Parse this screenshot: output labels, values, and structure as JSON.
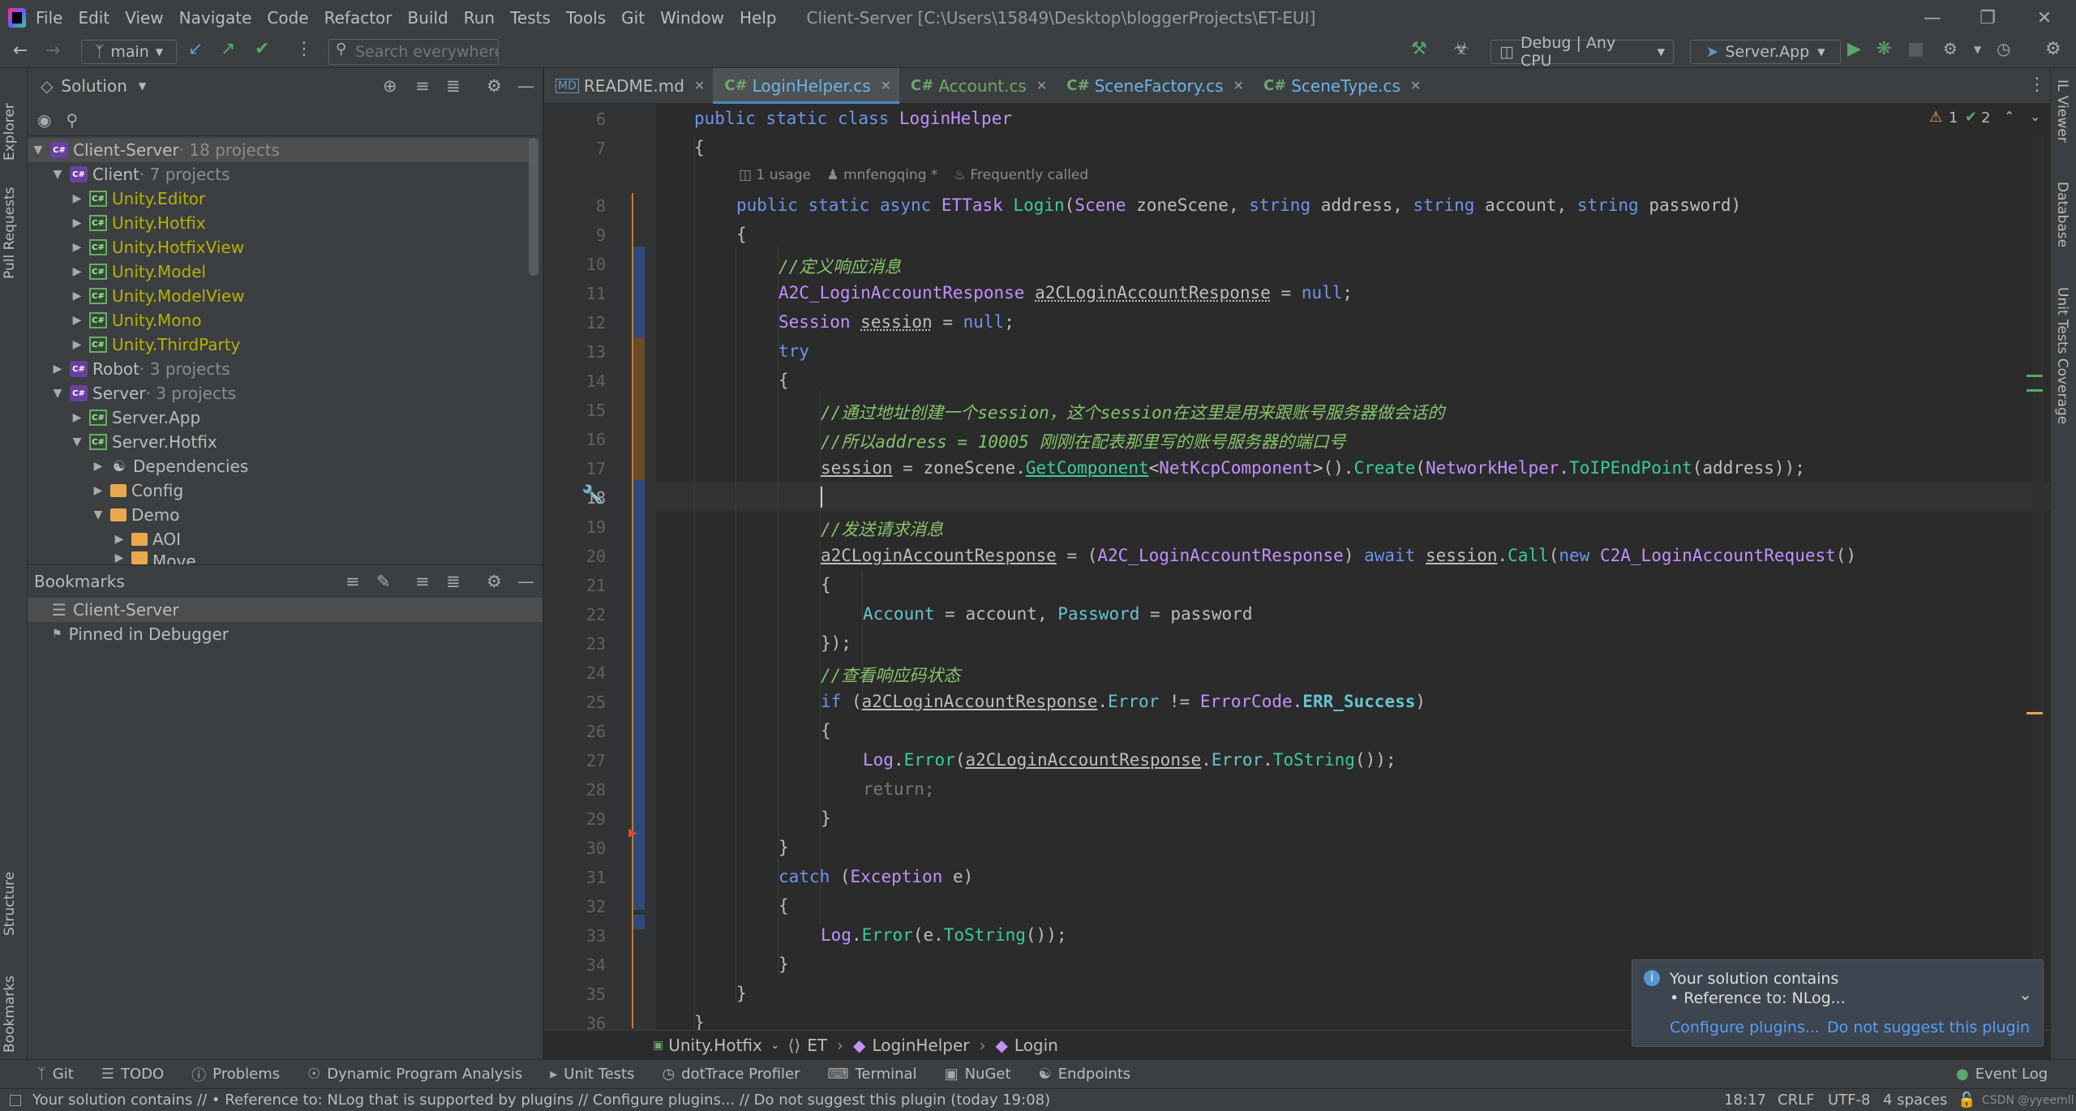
{
  "menubar": {
    "items": [
      "File",
      "Edit",
      "View",
      "Navigate",
      "Code",
      "Refactor",
      "Build",
      "Run",
      "Tests",
      "Tools",
      "Git",
      "Window",
      "Help"
    ],
    "title": "Client-Server [C:\\Users\\15849\\Desktop\\bloggerProjects\\ET-EUI]"
  },
  "toolbar": {
    "branch": "main",
    "search_placeholder": "Search everywhere",
    "config": "Debug | Any CPU",
    "run_target": "Server.App"
  },
  "left_strip": {
    "explorer": "Explorer",
    "pull_requests": "Pull Requests",
    "structure": "Structure",
    "bookmarks": "Bookmarks"
  },
  "right_strip": {
    "il_viewer": "IL Viewer",
    "database": "Database",
    "coverage": "Unit Tests Coverage"
  },
  "solution": {
    "title": "Solution",
    "root_name": "Client-Server",
    "root_count": " · 18 projects",
    "client_name": "Client",
    "client_count": " · 7 projects",
    "client_projects": [
      "Unity.Editor",
      "Unity.Hotfix",
      "Unity.HotfixView",
      "Unity.Model",
      "Unity.ModelView",
      "Unity.Mono",
      "Unity.ThirdParty"
    ],
    "robot_name": "Robot",
    "robot_count": " · 3 projects",
    "server_name": "Server",
    "server_count": " · 3 projects",
    "server_app": "Server.App",
    "server_hotfix": "Server.Hotfix",
    "dependencies": "Dependencies",
    "config": "Config",
    "demo": "Demo",
    "aoi": "AOI",
    "move": "Move"
  },
  "bookmarks_panel": {
    "title": "Bookmarks",
    "items": [
      "Client-Server",
      "Pinned in Debugger"
    ]
  },
  "tabs": [
    {
      "label": "README.md",
      "kind": "md"
    },
    {
      "label": "LoginHelper.cs",
      "kind": "C#"
    },
    {
      "label": "Account.cs",
      "kind": "C#"
    },
    {
      "label": "SceneFactory.cs",
      "kind": "C#"
    },
    {
      "label": "SceneType.cs",
      "kind": "C#"
    }
  ],
  "editor": {
    "warnings": "1",
    "checks": "2",
    "line_numbers": [
      "6",
      "7",
      "8",
      "9",
      "10",
      "11",
      "12",
      "13",
      "14",
      "15",
      "16",
      "17",
      "18",
      "19",
      "20",
      "21",
      "22",
      "23",
      "24",
      "25",
      "26",
      "27",
      "28",
      "29",
      "30",
      "31",
      "32",
      "33",
      "34",
      "35",
      "36"
    ],
    "hint_usage": "1 usage",
    "hint_author": "mnfengqing *",
    "hint_freq": "Frequently called",
    "line6": {
      "a": "public",
      "b": "static",
      "c": "class",
      "d": "LoginHelper"
    },
    "line8": {
      "a": "public",
      "b": "static",
      "c": "async",
      "d": "ETTask",
      "e": "Login",
      "f": "(",
      "g": "Scene",
      "h": " zoneScene, ",
      "i": "string",
      "j": " address, ",
      "k": "string",
      "l": " account, ",
      "m": "string",
      "n": " password)"
    },
    "c10": "//定义响应消息",
    "line11": {
      "a": "A2C_LoginAccountResponse",
      "b": " ",
      "c": "a2CLoginAccountResponse",
      "d": " = ",
      "e": "null",
      "f": ";"
    },
    "line12": {
      "a": "Session",
      "b": " ",
      "c": "session",
      "d": " = ",
      "e": "null",
      "f": ";"
    },
    "kw_try": "try",
    "c15": "//通过地址创建一个session，这个session在这里是用来跟账号服务器做会话的",
    "c16": "//所以address = 10005 刚刚在配表那里写的账号服务器的端口号",
    "line17": {
      "a": "session",
      "b": " = zoneScene.",
      "c": "GetComponent",
      "d": "<",
      "e": "NetKcpComponent",
      "f": ">().",
      "g": "Create",
      "h": "(",
      "i": "NetworkHelper",
      "j": ".",
      "k": "ToIPEndPoint",
      "l": "(address));"
    },
    "c19": "//发送请求消息",
    "line20": {
      "a": "a2CLoginAccountResponse",
      "b": " = (",
      "c": "A2C_LoginAccountResponse",
      "d": ") ",
      "e": "await",
      "f": " ",
      "g": "session",
      "h": ".",
      "i": "Call",
      "j": "(",
      "k": "new",
      "l": " ",
      "m": "C2A_LoginAccountRequest",
      "n": "()"
    },
    "line22": {
      "a": "Account",
      "b": " = account, ",
      "c": "Password",
      "d": " = password"
    },
    "line23": "});",
    "c24": "//查看响应码状态",
    "line25": {
      "a": "if",
      "b": " (",
      "c": "a2CLoginAccountResponse",
      "d": ".",
      "e": "Error",
      "f": " != ",
      "g": "ErrorCode",
      "h": ".",
      "i": "ERR_Success",
      "j": ")"
    },
    "line27": {
      "a": "Log",
      "b": ".",
      "c": "Error",
      "d": "(",
      "e": "a2CLoginAccountResponse",
      "f": ".",
      "g": "Error",
      "h": ".",
      "i": "ToString",
      "j": "());"
    },
    "line28": "return;",
    "line31": {
      "a": "catch",
      "b": " (",
      "c": "Exception",
      "d": " e)"
    },
    "line33": {
      "a": "Log",
      "b": ".",
      "c": "Error",
      "d": "(e.",
      "e": "ToString",
      "f": "());"
    },
    "brace_open": "{",
    "brace_close": "}"
  },
  "breadcrumbs": [
    "Unity.Hotfix",
    "ET",
    "LoginHelper",
    "Login"
  ],
  "notification": {
    "title": "Your solution contains",
    "detail": "• Reference to: NLog...",
    "action1": "Configure plugins...",
    "action2": "Do not suggest this plugin"
  },
  "bottom_tools": [
    "Git",
    "TODO",
    "Problems",
    "Dynamic Program Analysis",
    "Unit Tests",
    "dotTrace Profiler",
    "Terminal",
    "NuGet",
    "Endpoints"
  ],
  "event_log": "Event Log",
  "status": {
    "message": "Your solution contains // • Reference to: NLog that is supported by plugins // Configure plugins... // Do not suggest this plugin (today 19:08)",
    "position": "18:17",
    "line_sep": "CRLF",
    "encoding": "UTF-8",
    "indent": "4 spaces",
    "watermark": "CSDN @yyeemll"
  },
  "colors": {
    "accent": "#4a88c7",
    "keyword": "#6c95eb",
    "type": "#c191ff",
    "method": "#39cc9b",
    "comment": "#85c46c",
    "project": "#b5b100"
  }
}
